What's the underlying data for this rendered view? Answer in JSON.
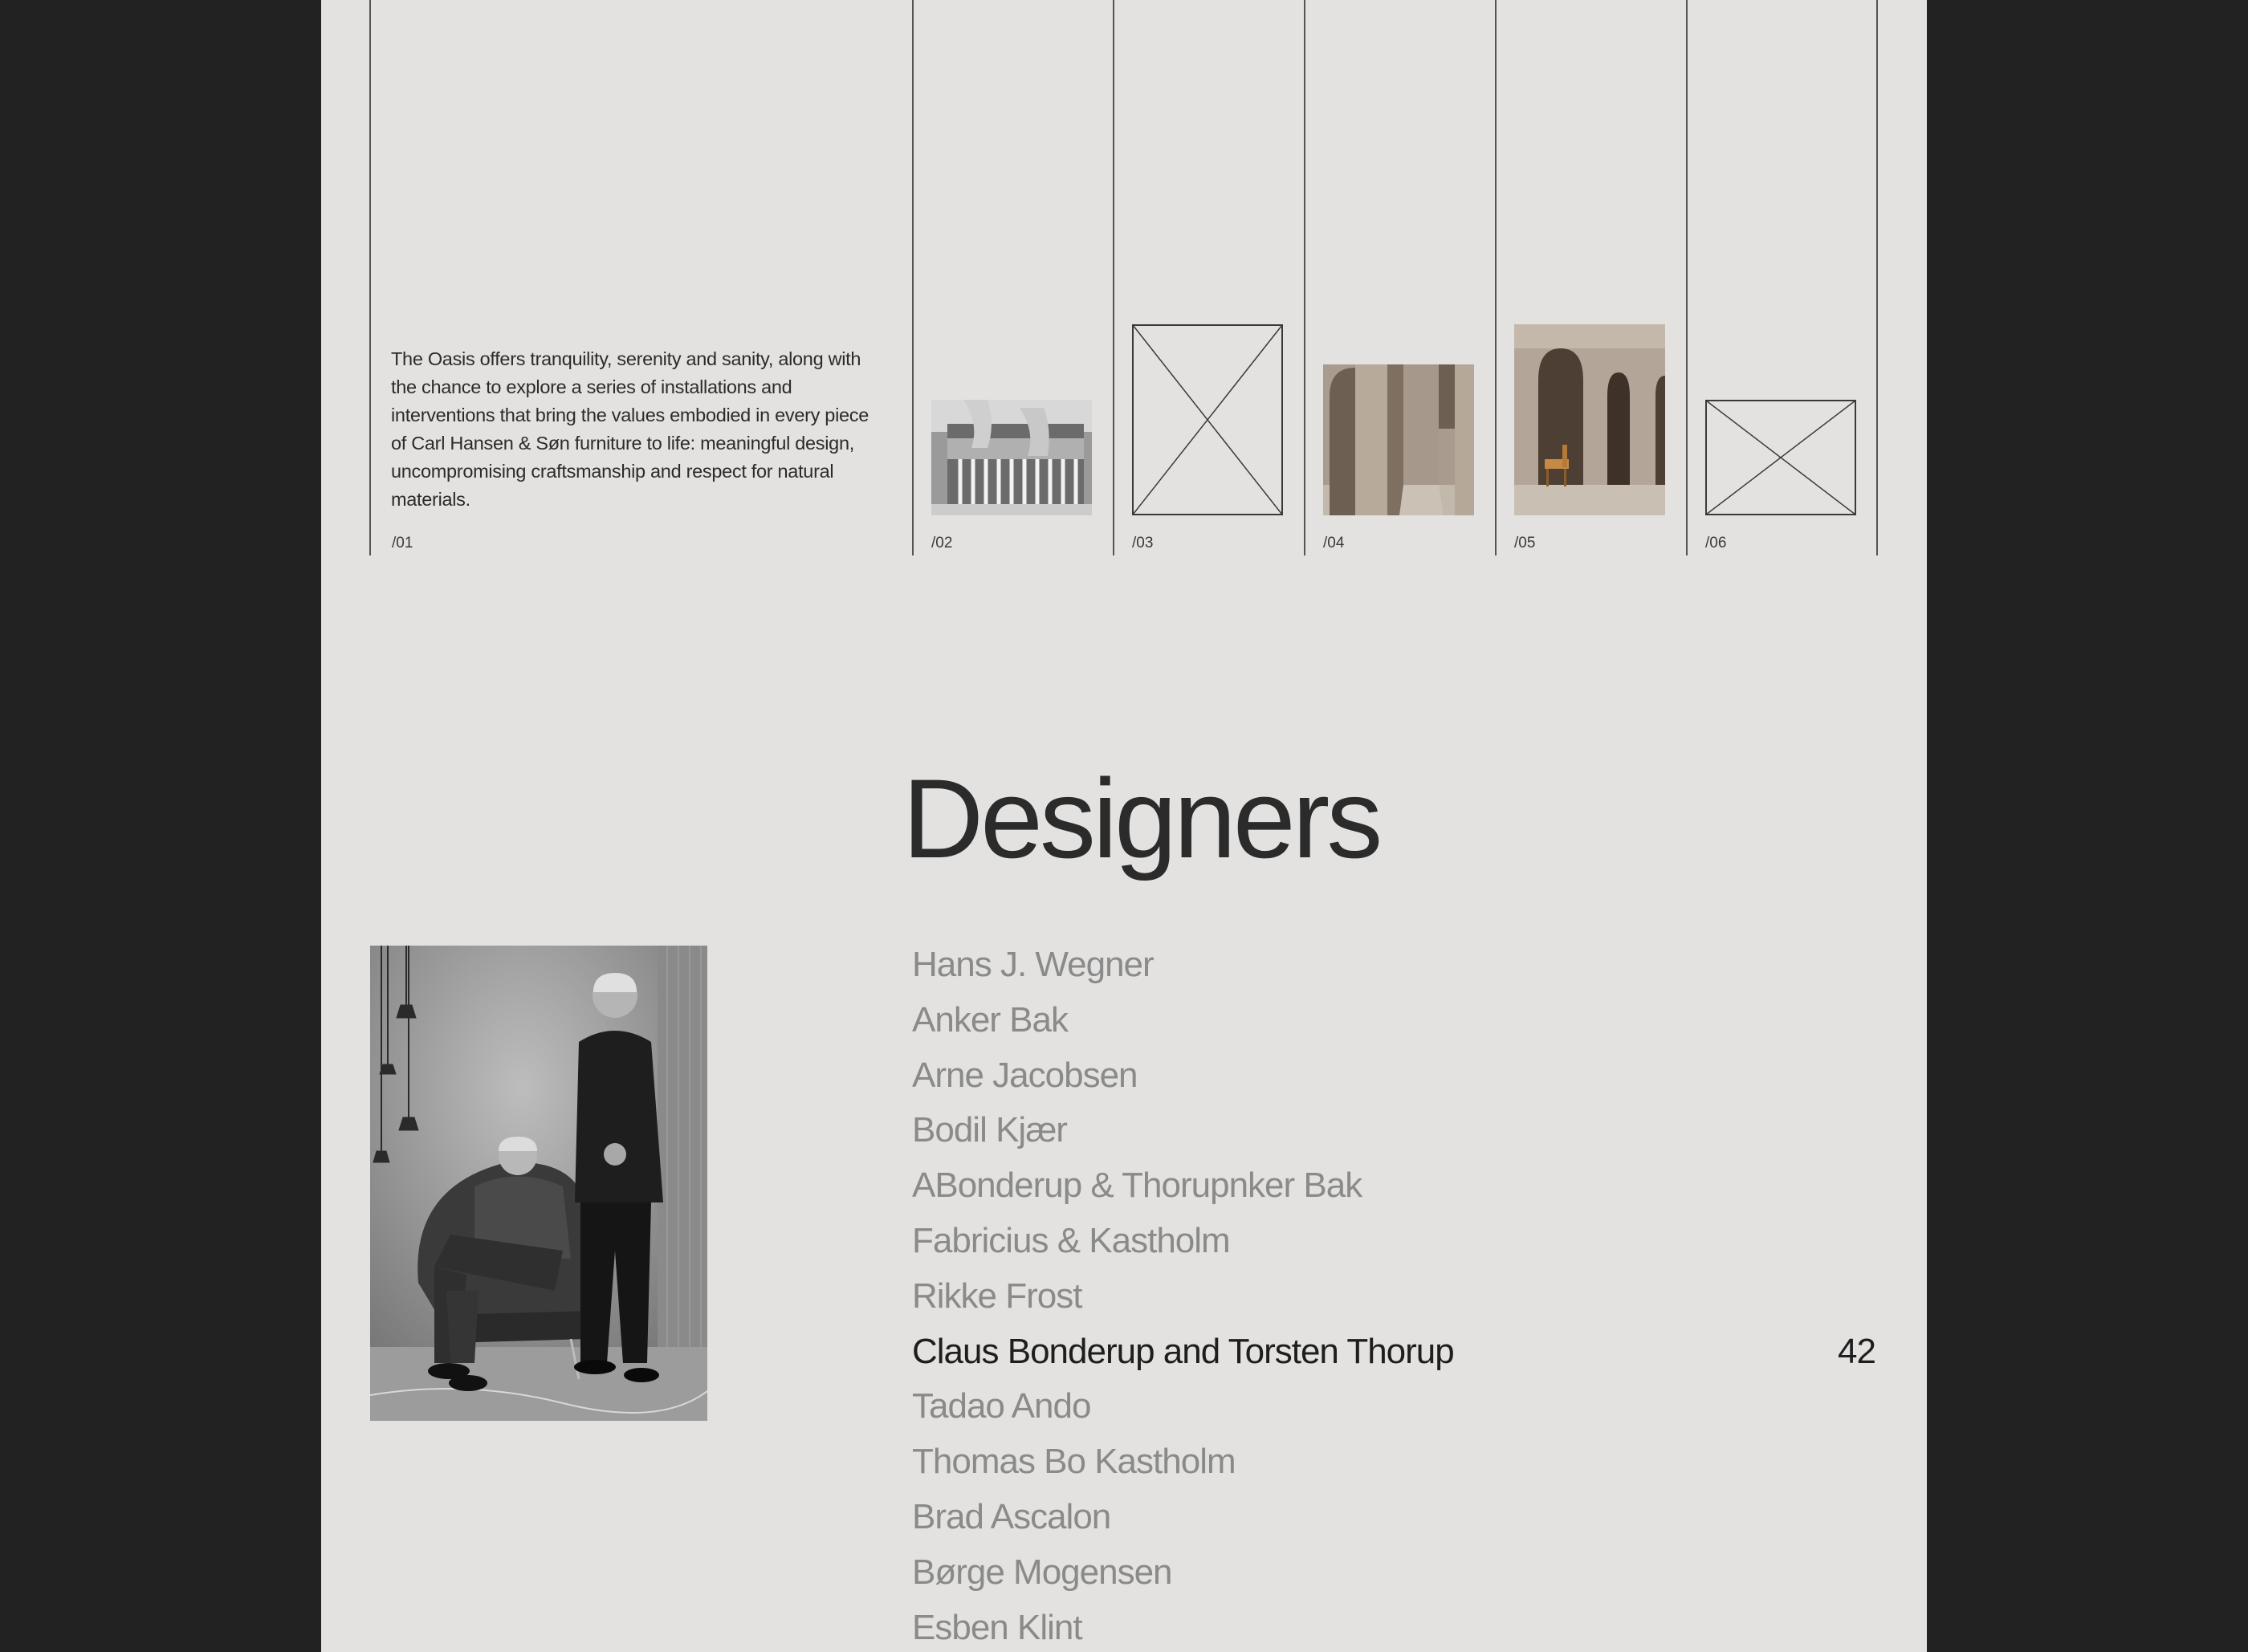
{
  "gallery": {
    "intro": "The Oasis offers tranquility, serenity and sanity, along with the chance to explore a series of installations and interventions that bring the values embodied in every piece of Carl Hansen & Søn furniture to life: meaningful design, uncompromising craftsmanship and respect for natural materials.",
    "columns": [
      {
        "index": "/01"
      },
      {
        "index": "/02"
      },
      {
        "index": "/03"
      },
      {
        "index": "/04"
      },
      {
        "index": "/05"
      },
      {
        "index": "/06"
      }
    ]
  },
  "designers": {
    "title": "Designers",
    "items": [
      "Hans J. Wegner",
      "Anker Bak",
      "Arne Jacobsen",
      "Bodil Kjær",
      "ABonderup & Thorupnker Bak",
      "Fabricius & Kastholm",
      "Rikke Frost",
      "Claus Bonderup and Torsten Thorup",
      "Tadao Ando",
      "Thomas Bo Kastholm",
      "Brad Ascalon",
      "Børge Mogensen",
      "Esben Klint"
    ],
    "active_index": 7,
    "active_count": "42"
  },
  "colors": {
    "frame": "#222222",
    "page": "#e3e2e0",
    "text_dark": "#1e1e1e",
    "text_muted": "#8a8a8a"
  }
}
